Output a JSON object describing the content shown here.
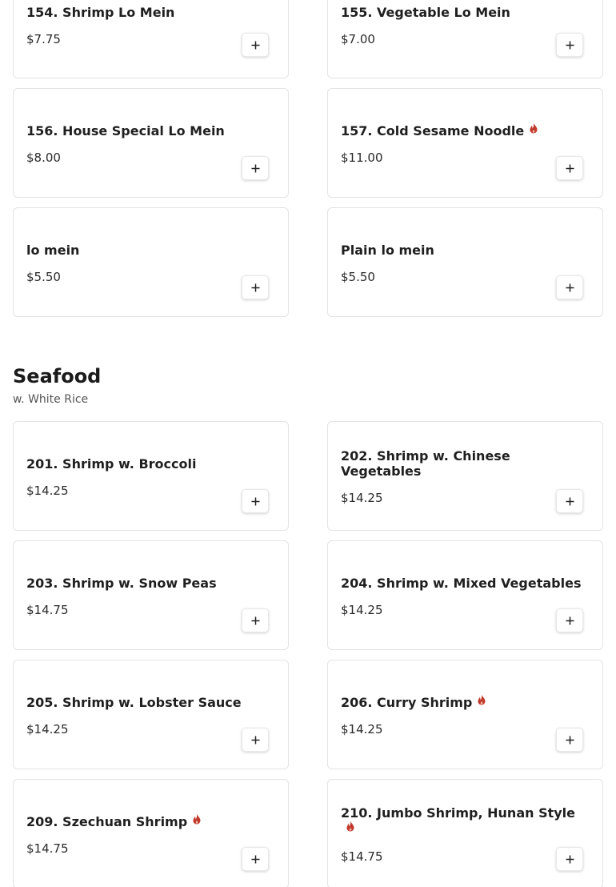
{
  "colors": {
    "spicy": "#c0392b",
    "border": "#e3e3e3",
    "text": "#1f1f1f"
  },
  "icons": {
    "add": "plus-icon",
    "spicy": "flame-icon"
  },
  "noodles": {
    "items": [
      {
        "name": "154. Shrimp Lo Mein",
        "price": "$7.75",
        "spicy": false
      },
      {
        "name": "155. Vegetable Lo Mein",
        "price": "$7.00",
        "spicy": false
      },
      {
        "name": "156. House Special Lo Mein",
        "price": "$8.00",
        "spicy": false
      },
      {
        "name": "157. Cold Sesame Noodle",
        "price": "$11.00",
        "spicy": true
      },
      {
        "name": "lo mein",
        "price": "$5.50",
        "spicy": false
      },
      {
        "name": "Plain lo mein",
        "price": "$5.50",
        "spicy": false
      }
    ]
  },
  "seafood": {
    "title": "Seafood",
    "subtitle": "w. White Rice",
    "items": [
      {
        "name": "201. Shrimp w. Broccoli",
        "price": "$14.25",
        "spicy": false
      },
      {
        "name": "202. Shrimp w. Chinese Vegetables",
        "price": "$14.25",
        "spicy": false
      },
      {
        "name": "203. Shrimp w. Snow Peas",
        "price": "$14.75",
        "spicy": false
      },
      {
        "name": "204. Shrimp w. Mixed Vegetables",
        "price": "$14.25",
        "spicy": false
      },
      {
        "name": "205. Shrimp w. Lobster Sauce",
        "price": "$14.25",
        "spicy": false
      },
      {
        "name": "206. Curry Shrimp",
        "price": "$14.25",
        "spicy": true
      },
      {
        "name": "209. Szechuan Shrimp",
        "price": "$14.75",
        "spicy": true
      },
      {
        "name": "210. Jumbo Shrimp, Hunan Style",
        "price": "$14.75",
        "spicy": true
      }
    ]
  }
}
